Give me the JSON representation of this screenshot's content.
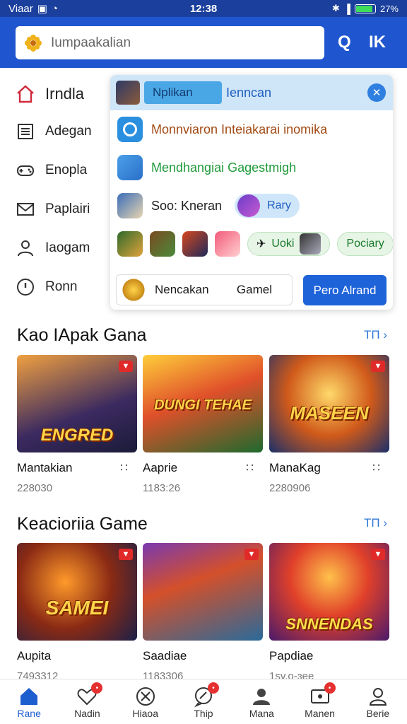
{
  "status": {
    "carrier": "Viaar",
    "time": "12:38",
    "battery": "27%"
  },
  "header": {
    "search_placeholder": "Iumpaakalian",
    "search_icon_label": "Q",
    "k_label": "IK"
  },
  "menu": [
    {
      "label": "Irndla",
      "icon": "home-icon"
    },
    {
      "label": "Adegan",
      "icon": "list-icon"
    },
    {
      "label": "Enopla",
      "icon": "gamepad-icon"
    },
    {
      "label": "Paplairi",
      "icon": "mail-icon"
    },
    {
      "label": "Iaogam",
      "icon": "person-icon"
    },
    {
      "label": "Ronn",
      "icon": "info-icon"
    }
  ],
  "panel": {
    "top_pill": "Nplikan",
    "top_text": "Ienncan",
    "row1": "Monnviaron Inteiakarai inomika",
    "row2": "Mendhangiai Gagestmigh",
    "row3_text": "Soo: Kneran",
    "row3_chip": "Rary",
    "row4_chip1": "Uoki",
    "row4_chip2": "Pociary",
    "bottom_left": "Nencakan",
    "bottom_right": "Gamel",
    "primary_button": "Pero Alrand"
  },
  "sections": [
    {
      "title": "Kao IApak Gana",
      "more": "TП",
      "cards": [
        {
          "name": "Mantakian",
          "num": "228030",
          "logo": "ENGRED"
        },
        {
          "name": "Aaprie",
          "num": "1183:26",
          "logo": "DUNGI TEHAE"
        },
        {
          "name": "ManaKag",
          "num": "2280906",
          "logo": "MASEEN"
        }
      ]
    },
    {
      "title": "Keacioriia Game",
      "more": "TП",
      "cards": [
        {
          "name": "Aupita",
          "num": "7493312",
          "logo": "SAMEI"
        },
        {
          "name": "Saadiae",
          "num": "1183306",
          "logo": ""
        },
        {
          "name": "Papdiae",
          "num": "1sv.o-ɜee",
          "logo": "SNNENDAS"
        }
      ]
    }
  ],
  "nav": [
    {
      "label": "Rane",
      "icon": "home-icon",
      "active": true
    },
    {
      "label": "Nadin",
      "icon": "heart-icon"
    },
    {
      "label": "Hiaoa",
      "icon": "compass-icon"
    },
    {
      "label": "Thip",
      "icon": "chat-icon"
    },
    {
      "label": "Mana",
      "icon": "user-icon"
    },
    {
      "label": "Manen",
      "icon": "tv-icon"
    },
    {
      "label": "Berie",
      "icon": "profile-icon"
    }
  ]
}
